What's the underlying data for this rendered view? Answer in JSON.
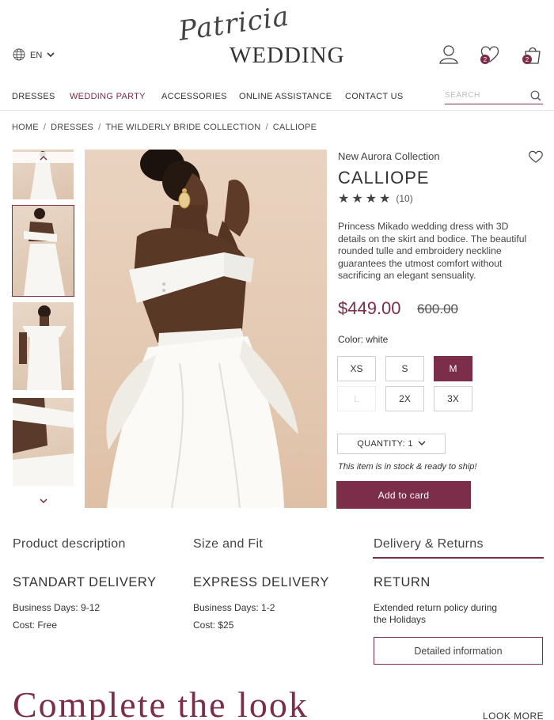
{
  "header": {
    "language": "EN",
    "logo_script": "Patricia",
    "logo_wordmark": "WEDDING",
    "wishlist_count": "2",
    "cart_count": "2"
  },
  "nav": {
    "items": [
      {
        "label": "DRESSES"
      },
      {
        "label": "WEDDING PARTY"
      },
      {
        "label": "ACCESSORIES"
      },
      {
        "label": "ONLINE ASSISTANCE"
      },
      {
        "label": "CONTACT US"
      }
    ],
    "active_index": 1,
    "search_placeholder": "SEARCH"
  },
  "breadcrumb": [
    "HOME",
    "DRESSES",
    "THE WILDERLY BRIDE COLLECTION",
    "CALLIOPE"
  ],
  "product": {
    "collection": "New Aurora Collection",
    "name": "CALLIOPE",
    "rating": 4,
    "rating_max": 4,
    "review_count": "(10)",
    "description": "Princess Mikado wedding dress with 3D details on the skirt and bodice. The beautiful rounded tulle and embroidery neckline guarantees the utmost comfort without sacrificing an elegant sensuality.",
    "price": "$449.00",
    "old_price": "600.00",
    "color_label": "Color: white",
    "sizes": [
      {
        "label": "XS",
        "state": "available"
      },
      {
        "label": "S",
        "state": "available"
      },
      {
        "label": "M",
        "state": "selected"
      },
      {
        "label": "L",
        "state": "unavailable"
      },
      {
        "label": "2X",
        "state": "available"
      },
      {
        "label": "3X",
        "state": "available"
      }
    ],
    "quantity_label": "QUANTITY: 1",
    "stock_text": "This item is in stock & ready to ship!",
    "add_button": "Add to card"
  },
  "tabs": {
    "items": [
      "Product description",
      "Size and Fit",
      "Delivery & Returns"
    ],
    "active_index": 2
  },
  "delivery": {
    "columns": [
      {
        "heading": "STANDART DELIVERY",
        "lines": [
          "Business Days: 9-12",
          "Cost: Free"
        ]
      },
      {
        "heading": "EXPRESS DELIVERY",
        "lines": [
          "Business Days: 1-2",
          "Cost: $25"
        ]
      },
      {
        "heading": "RETURN",
        "lines": [
          "Extended return policy during",
          "the Holidays"
        ]
      }
    ],
    "detail_button": "Detailed information"
  },
  "complete_look": {
    "heading": "Complete the look",
    "more_link": "LOOK MORE"
  },
  "colors": {
    "accent": "#7b2d4a",
    "text": "#333333",
    "photo_background": "#e6cfbb"
  }
}
